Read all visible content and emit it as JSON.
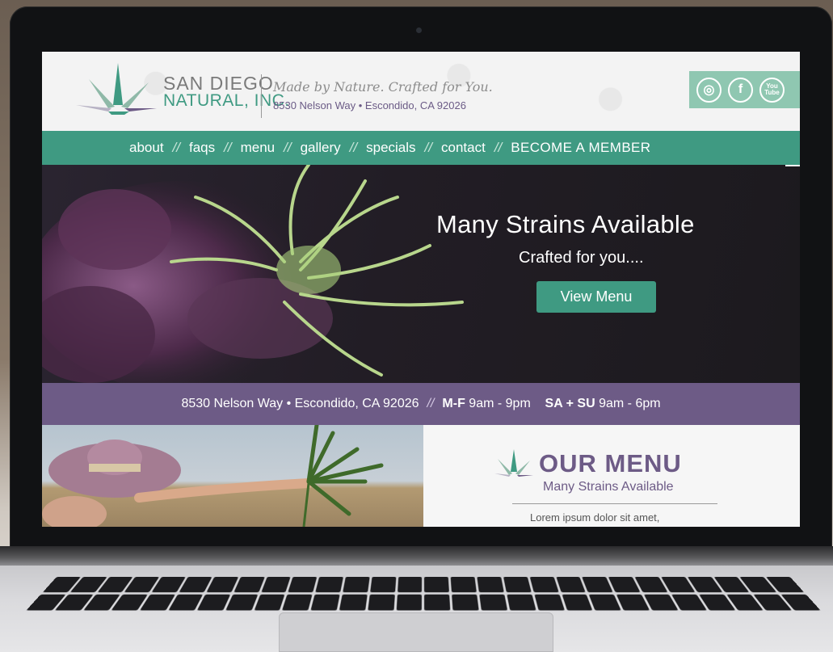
{
  "header": {
    "logo": {
      "line1": "SAN DIEGO",
      "line2": "NATURAL, INC."
    },
    "tagline": "Made by Nature. Crafted for You.",
    "address": "8530 Nelson Way • Escondido, CA 92026",
    "social": [
      {
        "icon": "instagram-icon",
        "glyph": "◎"
      },
      {
        "icon": "facebook-icon",
        "glyph": "f"
      },
      {
        "icon": "youtube-icon",
        "glyph": "You Tube"
      }
    ]
  },
  "nav": {
    "items": [
      "about",
      "faqs",
      "menu",
      "gallery",
      "specials",
      "contact"
    ],
    "separator": "//",
    "cta": "BECOME A MEMBER"
  },
  "hero": {
    "title": "Many Strains Available",
    "subtitle": "Crafted for you....",
    "button": "View Menu"
  },
  "info_bar": {
    "address": "8530 Nelson Way • Escondido, CA 92026",
    "separator": "//",
    "weekday_label": "M-F",
    "weekday_hours": "9am - 9pm",
    "weekend_label": "SA + SU",
    "weekend_hours": "9am - 6pm"
  },
  "menu_section": {
    "heading": "OUR MENU",
    "subheading": "Many Strains Available",
    "body": "Lorem ipsum dolor sit amet,"
  },
  "colors": {
    "brand_green": "#3f9a82",
    "brand_purple": "#6d5b86",
    "social_bg": "#8fc7b1"
  }
}
